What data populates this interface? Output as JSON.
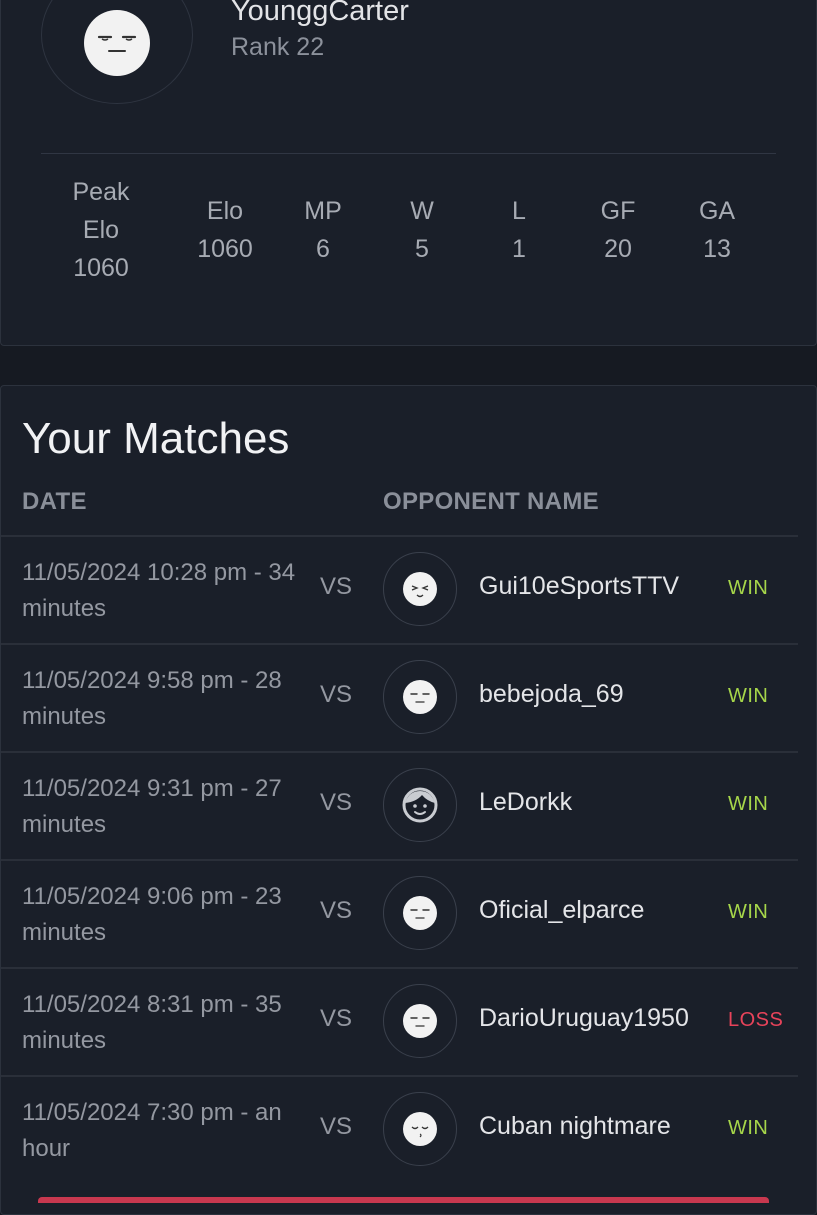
{
  "profile": {
    "username": "YounggCarter",
    "rank": "Rank 22",
    "stats": [
      {
        "label": "Peak\nElo",
        "value": "1060"
      },
      {
        "label": "Elo",
        "value": "1060"
      },
      {
        "label": "MP",
        "value": "6"
      },
      {
        "label": "W",
        "value": "5"
      },
      {
        "label": "L",
        "value": "1"
      },
      {
        "label": "GF",
        "value": "20"
      },
      {
        "label": "GA",
        "value": "13"
      }
    ]
  },
  "matches": {
    "title": "Your Matches",
    "columns": {
      "date": "DATE",
      "opponent": "OPPONENT NAME"
    },
    "vs_label": "VS",
    "rows": [
      {
        "date": "11/05/2024 10:28 pm - 34 minutes",
        "opponent": "Gui10eSportsTTV",
        "result": "WIN",
        "avatar": "wink-face-icon"
      },
      {
        "date": "11/05/2024 9:58 pm - 28 minutes",
        "opponent": "bebejoda_69",
        "result": "WIN",
        "avatar": "unamused-face-icon"
      },
      {
        "date": "11/05/2024 9:31 pm - 27 minutes",
        "opponent": "LeDorkk",
        "result": "WIN",
        "avatar": "smiling-person-icon"
      },
      {
        "date": "11/05/2024 9:06 pm - 23 minutes",
        "opponent": "Oficial_elparce",
        "result": "WIN",
        "avatar": "unamused-face-icon"
      },
      {
        "date": "11/05/2024 8:31 pm - 35 minutes",
        "opponent": "DarioUruguay1950",
        "result": "LOSS",
        "avatar": "unamused-face-icon"
      },
      {
        "date": "11/05/2024 7:30 pm - an hour",
        "opponent": "Cuban nightmare",
        "result": "WIN",
        "avatar": "sleepy-face-icon"
      }
    ]
  },
  "colors": {
    "win": "#a6d64a",
    "loss": "#e8435a",
    "background": "#161a22",
    "card": "#1a1f29"
  }
}
